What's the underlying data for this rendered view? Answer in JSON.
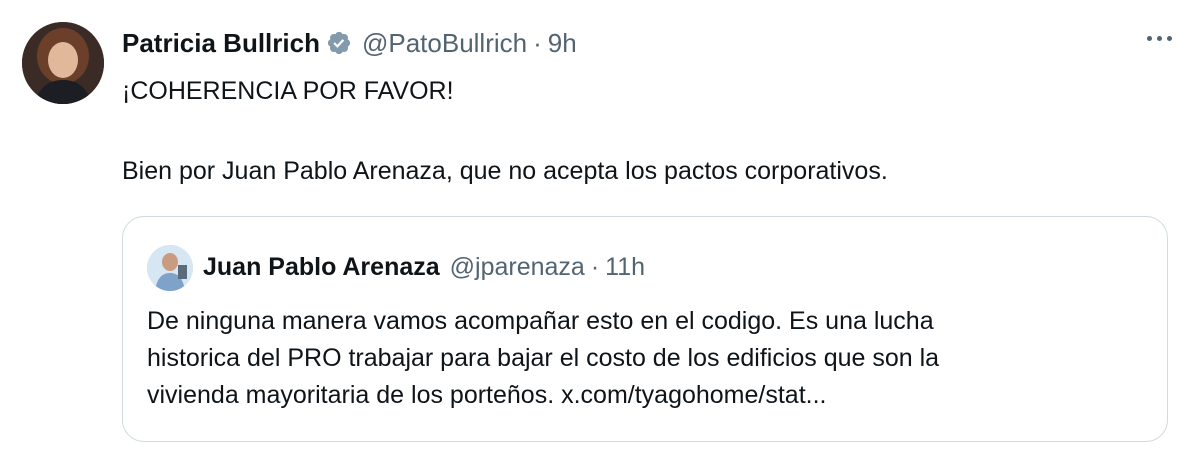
{
  "tweet": {
    "author_name": "Patricia Bullrich",
    "handle": "@PatoBullrich",
    "separator": "·",
    "time": "9h",
    "verified_color": "#829aab",
    "text_line1": "¡COHERENCIA POR FAVOR!",
    "text_line2": "Bien por Juan Pablo Arenaza, que no acepta los pactos corporativos."
  },
  "quote": {
    "author_name": "Juan Pablo Arenaza",
    "handle": "@jparenaza",
    "separator": "·",
    "time": "11h",
    "lines": [
      "De ninguna manera vamos acompañar esto en el codigo. Es una lucha",
      "historica del PRO trabajar para bajar el costo de los edificios que son la",
      "vivienda mayoritaria de los porteños. x.com/tyagohome/stat..."
    ]
  },
  "icons": {
    "verified": "verified-badge-icon",
    "more": "more-options-icon"
  }
}
